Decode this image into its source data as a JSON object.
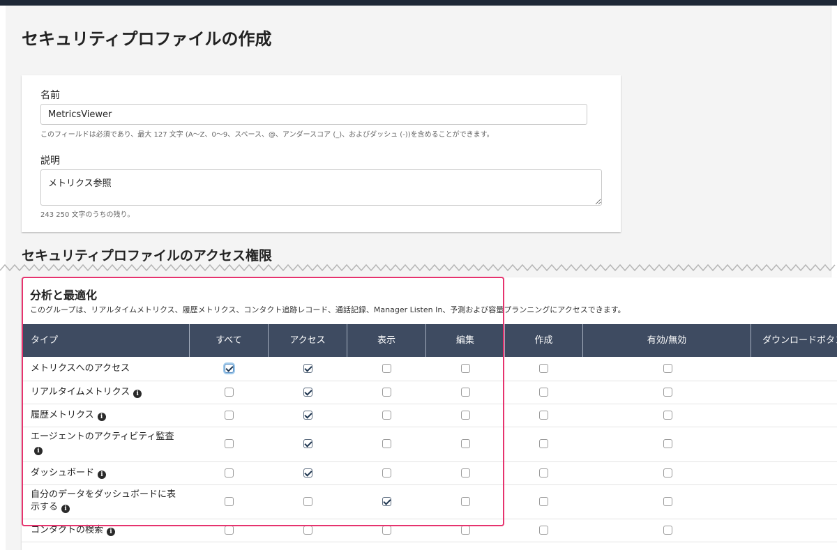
{
  "page": {
    "title": "セキュリティプロファイルの作成"
  },
  "form": {
    "name_label": "名前",
    "name_value": "MetricsViewer",
    "name_hint": "このフィールドは必須であり、最大 127 文字 (A〜Z、0〜9、スペース、@、アンダースコア (_)、およびダッシュ (-))を含めることができます。",
    "description_label": "説明",
    "description_value": "メトリクス参照",
    "description_hint": "243 250 文字のうちの残り。"
  },
  "permissions": {
    "section_title": "セキュリティプロファイルのアクセス権限",
    "group": {
      "title": "分析と最適化",
      "description": "このグループは、リアルタイムメトリクス、履歴メトリクス、コンタクト追跡レコード、通話記録、Manager Listen In、予測および容量プランニングにアクセスできます。"
    },
    "columns": [
      "タイプ",
      "すべて",
      "アクセス",
      "表示",
      "編集",
      "作成",
      "有効/無効",
      "ダウンロードボタン"
    ],
    "rows": [
      {
        "label": "メトリクスへのアクセス",
        "info": false,
        "checks": [
          true,
          true,
          false,
          false,
          false,
          false
        ]
      },
      {
        "label": "リアルタイムメトリクス",
        "info": true,
        "checks": [
          false,
          true,
          false,
          false,
          false,
          false
        ]
      },
      {
        "label": "履歴メトリクス",
        "info": true,
        "checks": [
          false,
          true,
          false,
          false,
          false,
          false
        ]
      },
      {
        "label": "エージェントのアクティビティ監査",
        "info": true,
        "checks": [
          false,
          true,
          false,
          false,
          false,
          false
        ]
      },
      {
        "label": "ダッシュボード",
        "info": true,
        "checks": [
          false,
          true,
          false,
          false,
          false,
          false
        ]
      },
      {
        "label": "自分のデータをダッシュボードに表示する",
        "info": true,
        "checks": [
          false,
          false,
          true,
          false,
          false,
          false
        ]
      },
      {
        "label": "コンタクトの検索",
        "info": true,
        "checks": [
          false,
          false,
          false,
          false,
          false,
          false
        ]
      }
    ]
  },
  "icons": {
    "info": "info-icon",
    "check": "checkmark-icon"
  },
  "colors": {
    "table_header": "#3e4b61",
    "highlight": "#e6336e",
    "checkmark": "#1f3650"
  }
}
